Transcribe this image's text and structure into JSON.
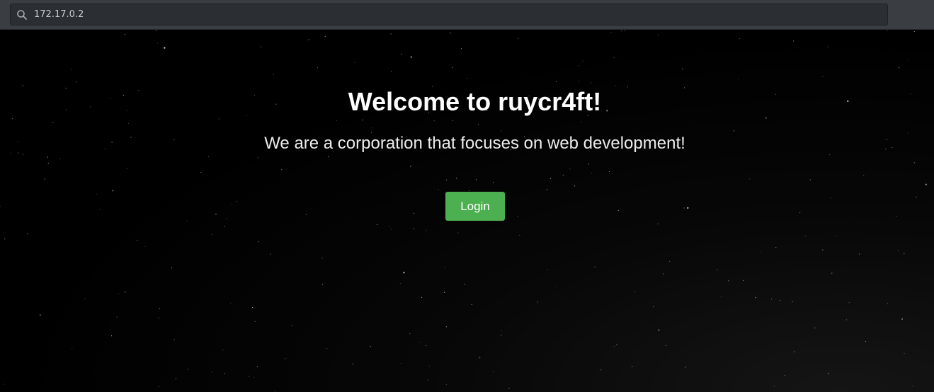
{
  "browser": {
    "url": "172.17.0.2",
    "search_icon": "search-icon"
  },
  "main": {
    "title": "Welcome to ruycr4ft!",
    "subtitle": "We are a corporation that focuses on web development!",
    "login_label": "Login"
  },
  "colors": {
    "background": "#000000",
    "button": "#4caf50",
    "text": "#ffffff"
  }
}
